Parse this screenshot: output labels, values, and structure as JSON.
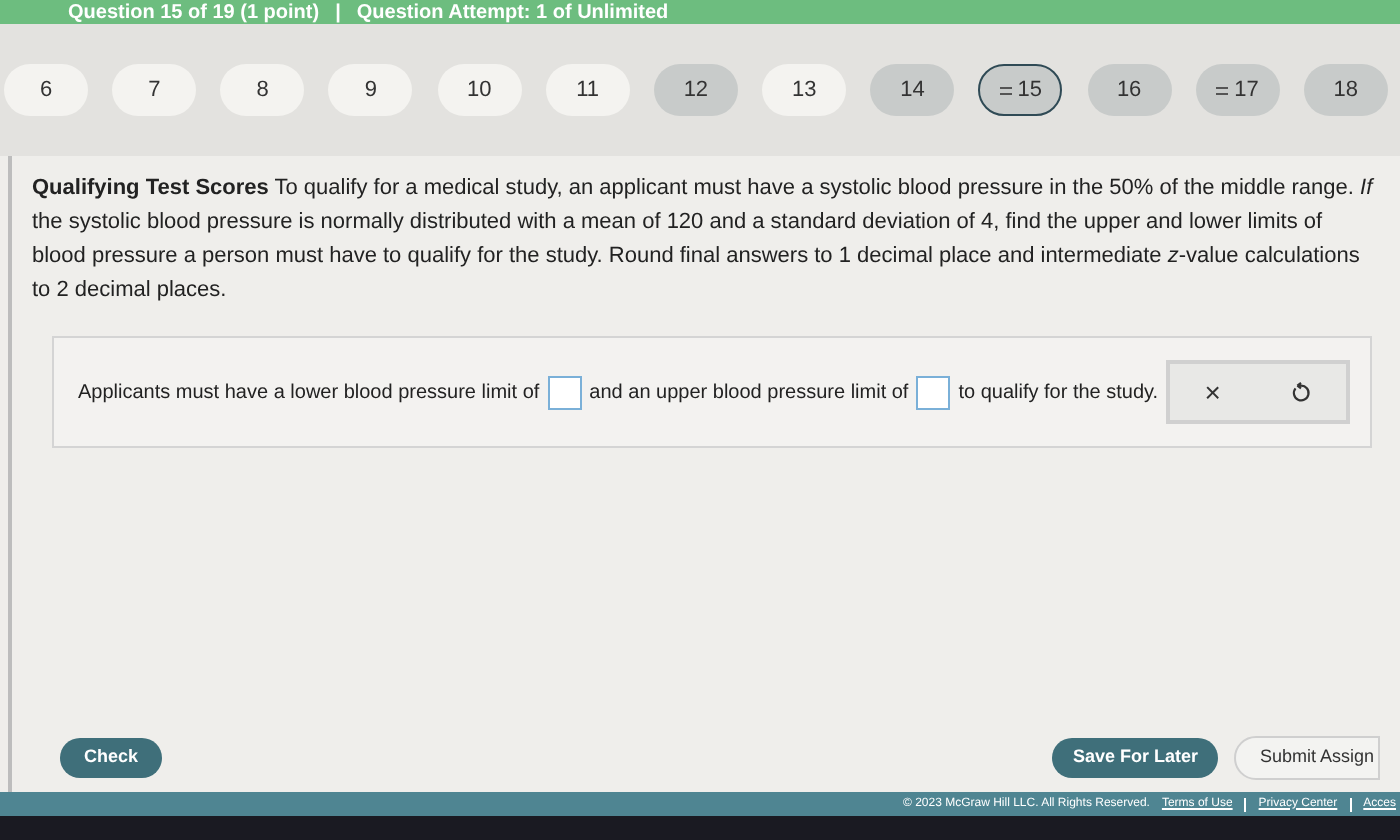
{
  "header": {
    "question": "Question 15 of 19 (1 point)",
    "separator": "|",
    "attempt": "Question Attempt: 1 of Unlimited"
  },
  "questions": [
    {
      "label": "6",
      "answered": false,
      "partial": false,
      "selected": false
    },
    {
      "label": "7",
      "answered": false,
      "partial": false,
      "selected": false
    },
    {
      "label": "8",
      "answered": false,
      "partial": false,
      "selected": false
    },
    {
      "label": "9",
      "answered": false,
      "partial": false,
      "selected": false
    },
    {
      "label": "10",
      "answered": false,
      "partial": false,
      "selected": false
    },
    {
      "label": "11",
      "answered": false,
      "partial": false,
      "selected": false
    },
    {
      "label": "12",
      "answered": true,
      "partial": false,
      "selected": false
    },
    {
      "label": "13",
      "answered": false,
      "partial": false,
      "selected": false
    },
    {
      "label": "14",
      "answered": true,
      "partial": false,
      "selected": false
    },
    {
      "label": "15",
      "answered": true,
      "partial": true,
      "selected": true
    },
    {
      "label": "16",
      "answered": true,
      "partial": false,
      "selected": false
    },
    {
      "label": "17",
      "answered": true,
      "partial": true,
      "selected": false
    },
    {
      "label": "18",
      "answered": true,
      "partial": false,
      "selected": false
    }
  ],
  "problem": "**Qualifying Test Scores** To qualify for a medical study, an applicant must have a systolic blood pressure in the 50% of the middle range. *If* the systolic blood pressure is normally distributed with a mean of 120 and a standard deviation of 4, find the upper and lower limits of blood pressure a person must have to qualify for the study. Round final answers to 1 decimal place and intermediate *z*-value calculations to 2 decimal places.",
  "answer": {
    "before": "Applicants must have a lower blood pressure limit of",
    "middle": "and an upper blood pressure limit of",
    "after": "to qualify for the study.",
    "clear": "×"
  },
  "buttons": {
    "check": "Check",
    "save": "Save For Later",
    "submit": "Submit Assign"
  },
  "footer": {
    "copyright": "© 2023 McGraw Hill LLC. All Rights Reserved.",
    "links": [
      "Terms of Use",
      "Privacy Center",
      "Acces"
    ]
  }
}
